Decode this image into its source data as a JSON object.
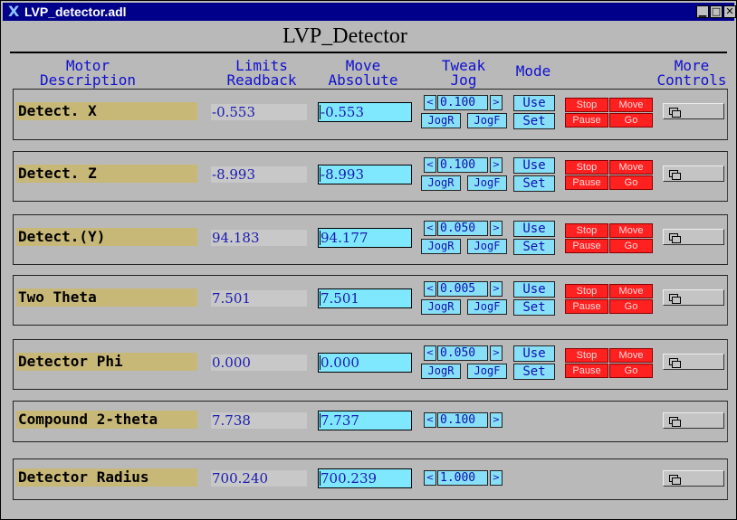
{
  "window": {
    "title": "LVP_detector.adl",
    "icon": "x-window-icon",
    "controls": {
      "minimize": "▁",
      "maximize": "□",
      "close": "✕"
    }
  },
  "page_title": "LVP_Detector",
  "headers": {
    "motor": "Motor\nDescription",
    "limits": "Limits\nReadback",
    "move": "Move\nAbsolute",
    "tweak": "Tweak\nJog",
    "mode": "Mode",
    "more": "More\nControls"
  },
  "labels": {
    "tweak_left": "<",
    "tweak_right": ">",
    "jog_reverse": "JogR",
    "jog_forward": "JogF",
    "use": "Use",
    "set": "Set",
    "stop": "Stop",
    "move": "Move",
    "pause": "Pause",
    "go": "Go"
  },
  "motors": [
    {
      "description": "Detect. X",
      "readback": "-0.553",
      "move_absolute": "-0.553",
      "tweak": "0.100"
    },
    {
      "description": "Detect. Z",
      "readback": "-8.993",
      "move_absolute": "-8.993",
      "tweak": "0.100"
    },
    {
      "description": "Detect.(Y)",
      "readback": "94.183",
      "move_absolute": "94.177",
      "tweak": "0.050"
    },
    {
      "description": "Two Theta",
      "readback": "7.501",
      "move_absolute": "7.501",
      "tweak": "0.005"
    },
    {
      "description": "Detector Phi",
      "readback": "0.000",
      "move_absolute": "0.000",
      "tweak": "0.050"
    },
    {
      "description": "Compound 2-theta",
      "readback": "7.738",
      "move_absolute": "7.737",
      "tweak": "0.100"
    },
    {
      "description": "Detector Radius",
      "readback": "700.240",
      "move_absolute": "700.239",
      "tweak": "1.000"
    }
  ],
  "colors": {
    "description_bg": "#c8b878",
    "field_bg": "#7fe8ff",
    "stop_red": "#ff2020",
    "header_blue": "#1010d0",
    "titlebar": "#00008b"
  }
}
